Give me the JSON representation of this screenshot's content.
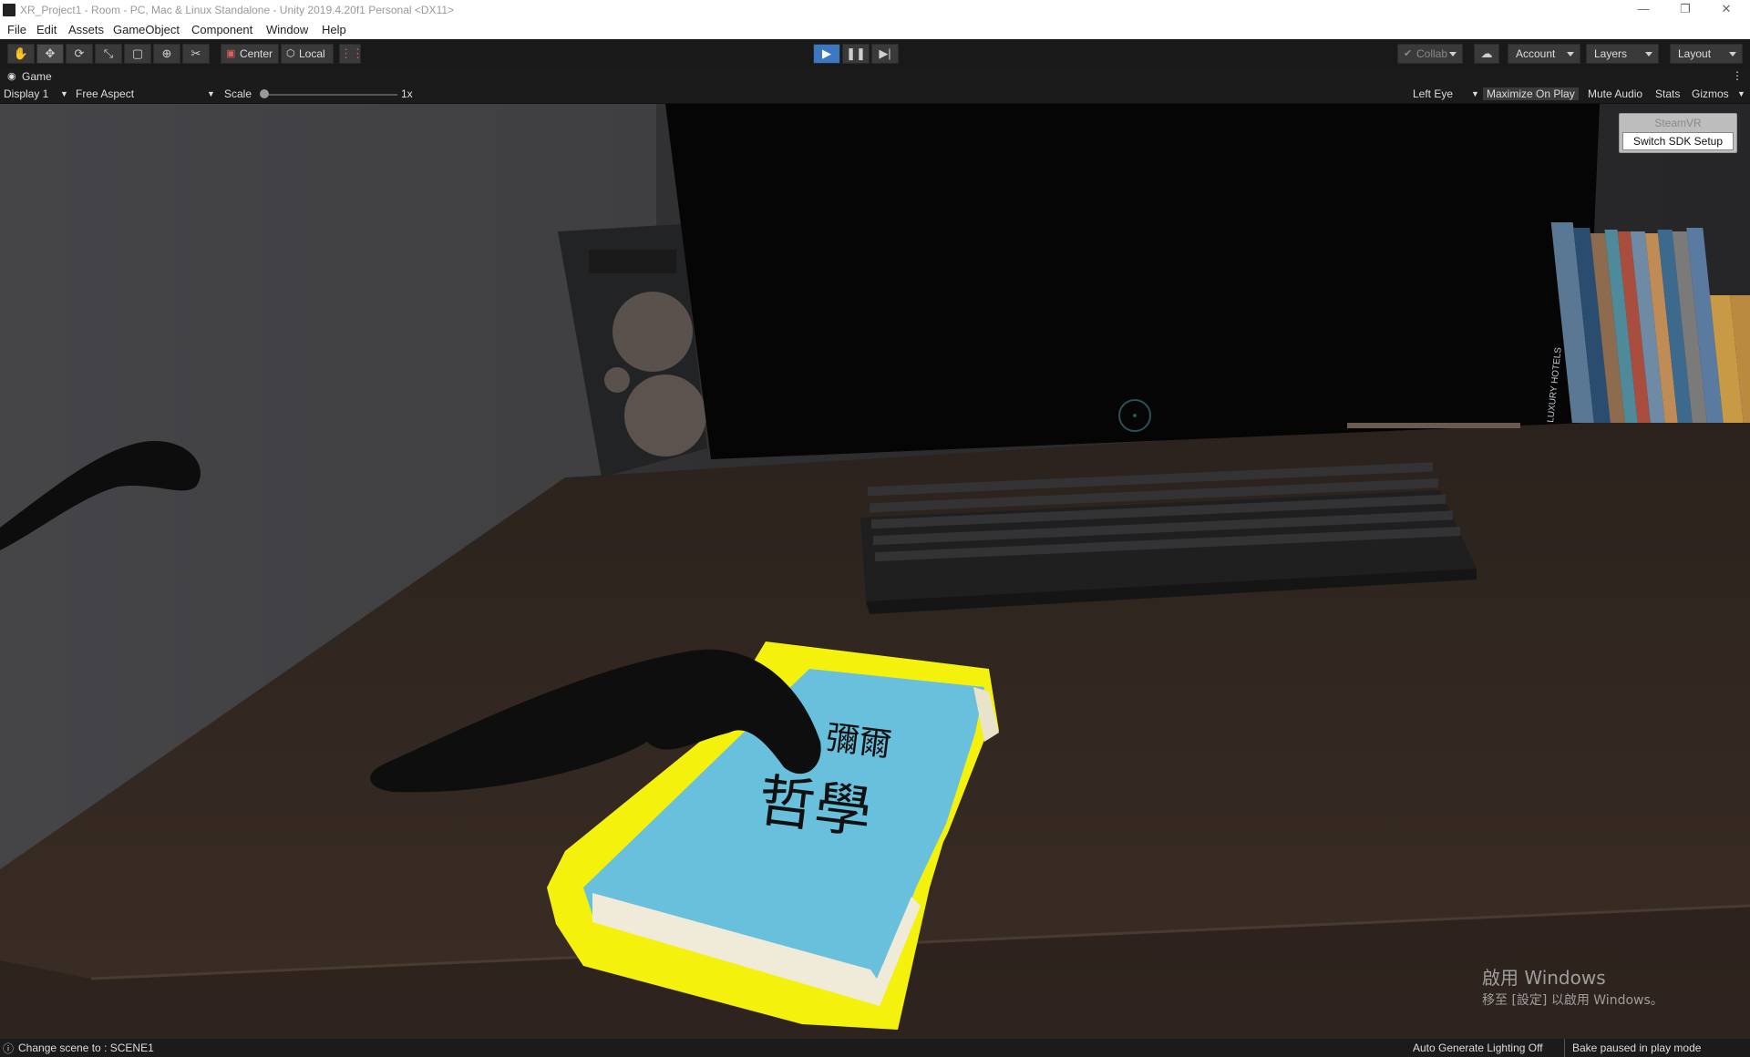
{
  "window": {
    "title": "XR_Project1 - Room - PC, Mac & Linux Standalone - Unity 2019.4.20f1 Personal <DX11>",
    "controls": [
      "—",
      "❐",
      "✕"
    ]
  },
  "menu": [
    "File",
    "Edit",
    "Assets",
    "GameObject",
    "Component",
    "Window",
    "Help"
  ],
  "toolbar": {
    "tools": [
      "hand-icon",
      "move-icon",
      "rotate-icon",
      "scale-icon",
      "rect-transform-icon",
      "transform-icon",
      "custom-tool-icon"
    ],
    "pivot_label": "Center",
    "space_label": "Local",
    "collab_label": "Collab",
    "account_label": "Account",
    "layers_label": "Layers",
    "layout_label": "Layout"
  },
  "game_view": {
    "tab_label": "Game",
    "display": "Display 1",
    "aspect": "Free Aspect",
    "scale_label": "Scale",
    "scale_value": "1x",
    "eye": "Left Eye",
    "maximize": "Maximize On Play",
    "mute": "Mute Audio",
    "stats": "Stats",
    "gizmos": "Gizmos"
  },
  "overlay": {
    "steamvr_label": "SteamVR",
    "switch_sdk_button": "Switch SDK Setup"
  },
  "scene_text": {
    "book_line1": "彌爾",
    "book_line2": "哲學",
    "book_spine_1": "LUXURY HOTELS",
    "activate_title": "啟用 Windows",
    "activate_sub": "移至 [設定] 以啟用 Windows。"
  },
  "status": {
    "message": "Change scene to : SCENE1",
    "auto_lighting": "Auto Generate Lighting Off",
    "bake": "Bake paused in play mode"
  }
}
